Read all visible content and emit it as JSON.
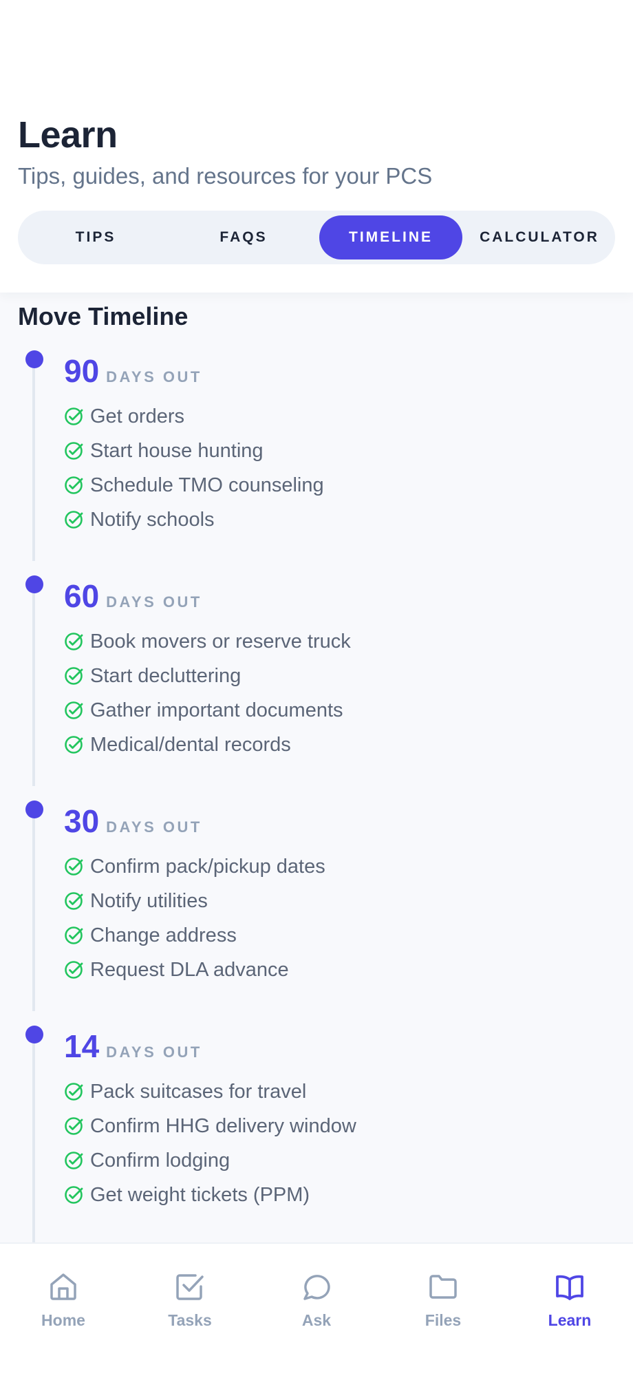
{
  "header": {
    "title": "Learn",
    "subtitle": "Tips, guides, and resources for your PCS"
  },
  "tabs": [
    {
      "label": "TIPS",
      "active": false
    },
    {
      "label": "FAQS",
      "active": false
    },
    {
      "label": "TIMELINE",
      "active": true
    },
    {
      "label": "CALCULATOR",
      "active": false
    }
  ],
  "timeline": {
    "title": "Move Timeline",
    "days_label": "DAYS OUT",
    "groups": [
      {
        "days": "90",
        "tasks": [
          "Get orders",
          "Start house hunting",
          "Schedule TMO counseling",
          "Notify schools"
        ]
      },
      {
        "days": "60",
        "tasks": [
          "Book movers or reserve truck",
          "Start decluttering",
          "Gather important documents",
          "Medical/dental records"
        ]
      },
      {
        "days": "30",
        "tasks": [
          "Confirm pack/pickup dates",
          "Notify utilities",
          "Change address",
          "Request DLA advance"
        ]
      },
      {
        "days": "14",
        "tasks": [
          "Pack suitcases for travel",
          "Confirm HHG delivery window",
          "Confirm lodging",
          "Get weight tickets (PPM)"
        ]
      }
    ]
  },
  "bottom_nav": [
    {
      "label": "Home",
      "icon": "home-icon",
      "active": false
    },
    {
      "label": "Tasks",
      "icon": "checkbox-icon",
      "active": false
    },
    {
      "label": "Ask",
      "icon": "chat-bubble-icon",
      "active": false
    },
    {
      "label": "Files",
      "icon": "folder-icon",
      "active": false
    },
    {
      "label": "Learn",
      "icon": "book-icon",
      "active": true
    }
  ],
  "colors": {
    "accent": "#4f46e5",
    "check": "#22c55e",
    "muted": "#94a3b8",
    "text": "#1c2436"
  }
}
